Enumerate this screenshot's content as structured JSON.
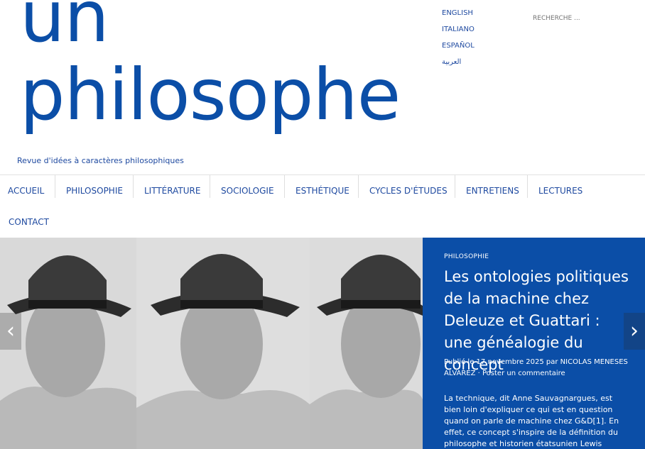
{
  "site": {
    "logo_line1": "un",
    "logo_line2": "philosophe",
    "tagline": "Revue d'idées à caractères philosophiques"
  },
  "languages": [
    "ENGLISH",
    "ITALIANO",
    "ESPAÑOL",
    "العربية"
  ],
  "search": {
    "placeholder": "RECHERCHE ..."
  },
  "nav": {
    "items": [
      "ACCUEIL",
      "PHILOSOPHIE",
      "LITTÉRATURE",
      "SOCIOLOGIE",
      "ESTHÉTIQUE",
      "CYCLES D'ÉTUDES",
      "ENTRETIENS",
      "LECTURES",
      "CONTACT"
    ]
  },
  "featured": {
    "category": "PHILOSOPHIE",
    "title": "Les ontologies politiques de la machine chez Deleuze et Guattari : une généalogie du concept",
    "meta": "Publié le 17 novembre 2025 par NICOLAS MENESES ALVAREZ · Poster un commentaire",
    "excerpt": "La technique, dit Anne Sauvagnargues, est bien loin d'expliquer ce qui est en question quand on parle de machine chez G&D[1]. En effet, ce concept s'inspire de la définition du philosophe et historien étatsunien Lewis"
  },
  "slider": {
    "prev_icon": "chevron-left-icon",
    "next_icon": "chevron-right-icon"
  },
  "colors": {
    "brand": "#0b4ea7",
    "text": "#1f4aa0"
  }
}
